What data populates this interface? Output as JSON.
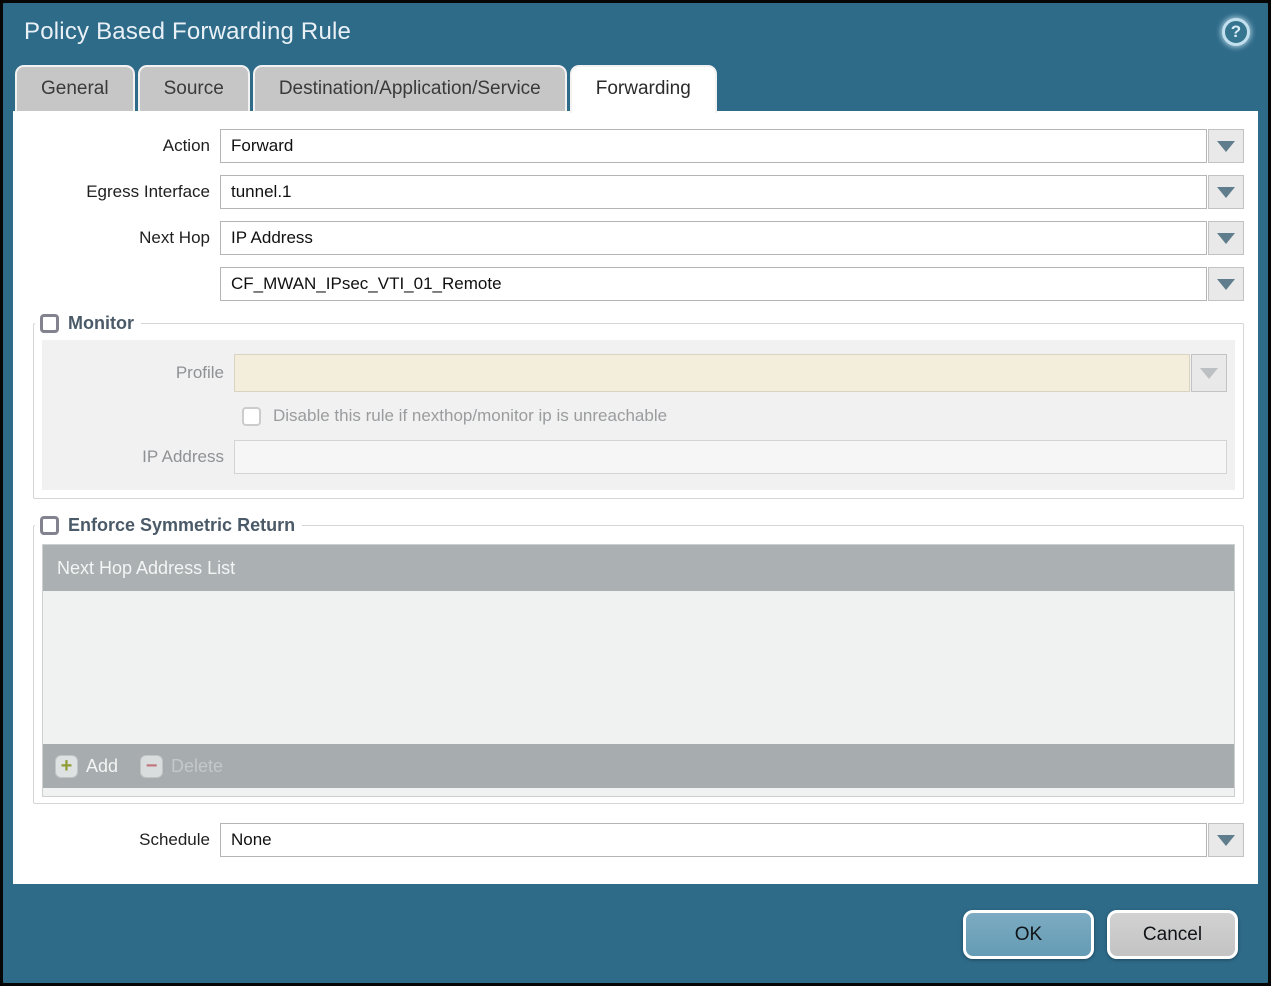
{
  "dialog": {
    "title": "Policy Based Forwarding Rule",
    "help_icon_glyph": "?",
    "tabs": [
      {
        "label": "General",
        "active": false
      },
      {
        "label": "Source",
        "active": false
      },
      {
        "label": "Destination/Application/Service",
        "active": false
      },
      {
        "label": "Forwarding",
        "active": true
      }
    ],
    "fields": {
      "action": {
        "label": "Action",
        "value": "Forward"
      },
      "egress_interface": {
        "label": "Egress Interface",
        "value": "tunnel.1"
      },
      "next_hop": {
        "label": "Next Hop",
        "value": "IP Address"
      },
      "next_hop_address": {
        "value": "CF_MWAN_IPsec_VTI_01_Remote"
      },
      "schedule": {
        "label": "Schedule",
        "value": "None"
      }
    },
    "monitor": {
      "legend": "Monitor",
      "checked": false,
      "profile": {
        "label": "Profile",
        "value": ""
      },
      "disable_rule_caption": "Disable this rule if nexthop/monitor ip is unreachable",
      "ip_address": {
        "label": "IP Address",
        "value": ""
      }
    },
    "symmetric_return": {
      "legend": "Enforce Symmetric Return",
      "checked": false,
      "table_header": "Next Hop Address List",
      "add_label": "Add",
      "delete_label": "Delete",
      "rows": []
    },
    "footer": {
      "ok_label": "OK",
      "cancel_label": "Cancel"
    },
    "colors": {
      "frame_teal": "#2e6b89",
      "active_tab": "#ffffff",
      "inactive_tab": "#c6c6c6",
      "disabled_field_cream": "#f3eddc",
      "table_header_gray": "#abb0b3",
      "ok_button_blue": "#6fa3ba",
      "add_plus_green": "#8f9c33",
      "delete_minus_red": "#c0777d"
    }
  }
}
